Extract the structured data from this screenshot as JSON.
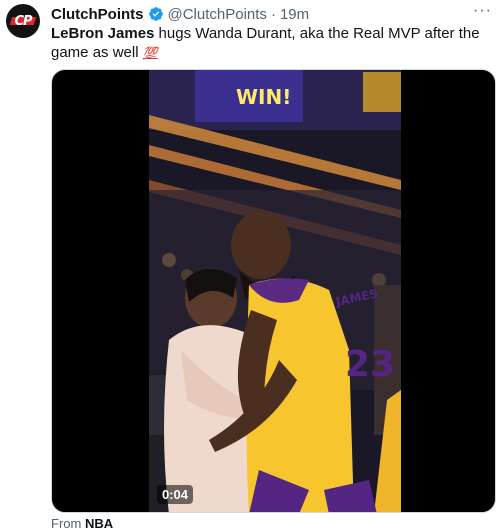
{
  "author": {
    "name": "ClutchPoints",
    "handle": "@ClutchPoints",
    "separator": "·",
    "time": "19m",
    "avatar_icon": "clutchpoints-logo",
    "avatar_logo_text": "CP",
    "verified_icon": "verified-badge-icon"
  },
  "more_label": "···",
  "tweet": {
    "subject": "LeBron James",
    "text": " hugs Wanda Durant, aka the Real MVP after the game as well ",
    "emoji": "💯"
  },
  "media": {
    "type": "video",
    "duration": "0:04",
    "banner_text": "WIN!",
    "jersey_name": "JAMES",
    "jersey_number": "23"
  },
  "footer": {
    "from_label": "From",
    "source": "NBA"
  },
  "colors": {
    "verified": "#1d9bf0",
    "lakers_gold": "#fdb927",
    "lakers_purple": "#552583",
    "brand_red": "#e0252b"
  }
}
